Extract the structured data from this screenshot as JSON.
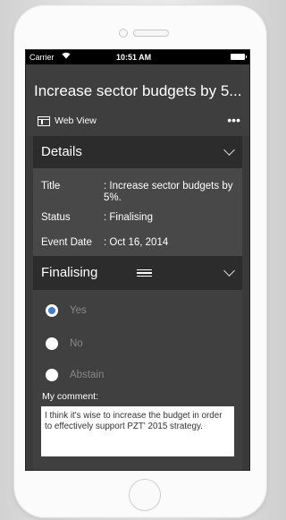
{
  "status_bar": {
    "carrier": "Carrier",
    "wifi_icon": "wifi-icon",
    "time": "10:51 AM",
    "battery_icon": "battery-icon"
  },
  "header": {
    "title": "Increase sector budgets by 5...",
    "web_view_label": "Web View",
    "web_view_icon": "calendar-window-icon",
    "more_icon": "more-horizontal-icon",
    "more_glyph": "•••"
  },
  "details": {
    "heading": "Details",
    "rows": [
      {
        "label": "Title",
        "value": ": Increase sector budgets by 5%."
      },
      {
        "label": "Status",
        "value": ": Finalising"
      },
      {
        "label": "Event Date",
        "value": ": Oct 16, 2014"
      }
    ]
  },
  "finalising": {
    "heading": "Finalising",
    "options": [
      {
        "label": "Yes",
        "selected": true
      },
      {
        "label": "No",
        "selected": false
      },
      {
        "label": "Abstain",
        "selected": false
      }
    ],
    "comment_label": "My comment:",
    "comment_text": "I think it's wise to increase the budget in order to effectively support PZT' 2015 strategy."
  },
  "colors": {
    "accent": "#3b7fd6",
    "background": "#3a3a3a",
    "section_header": "#2c2c2c"
  }
}
